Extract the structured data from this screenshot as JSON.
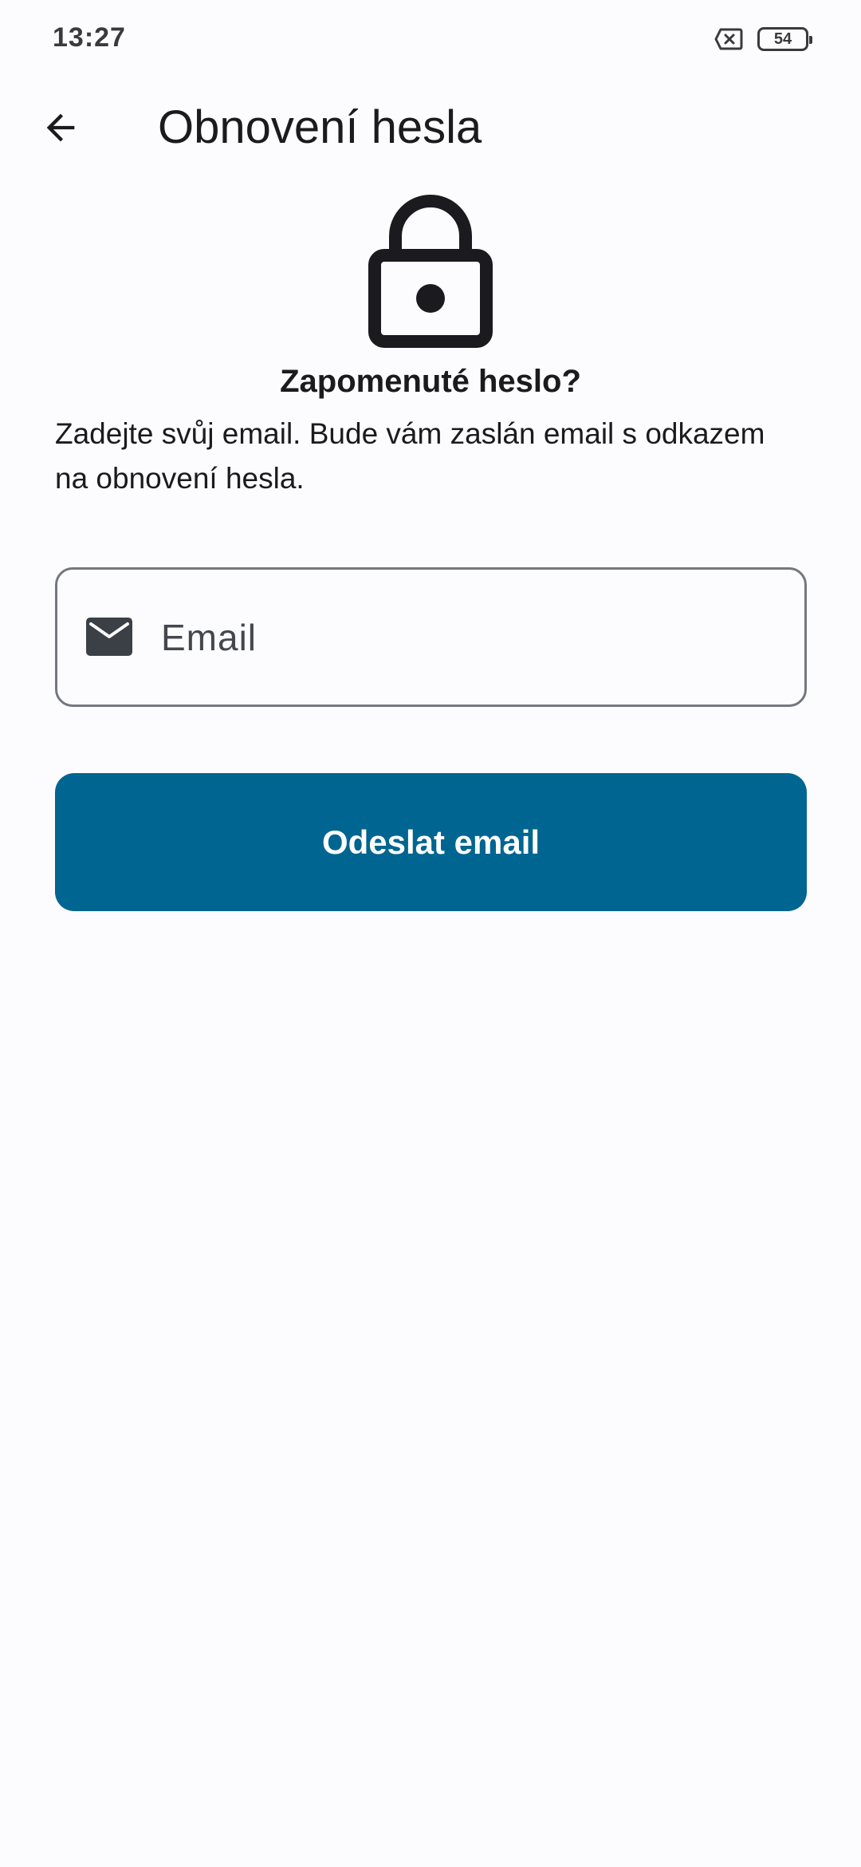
{
  "status_bar": {
    "time": "13:27",
    "battery": "54"
  },
  "top_bar": {
    "title": "Obnovení hesla"
  },
  "content": {
    "heading": "Zapomenuté heslo?",
    "description": "Zadejte svůj email. Bude vám zaslán email s odkazem na obnovení hesla.",
    "email_placeholder": "Email",
    "email_value": "",
    "submit_label": "Odeslat email"
  },
  "icons": {
    "back": "arrow-back-icon",
    "lock": "lock-icon",
    "mail": "mail-icon",
    "sim": "no-sim-icon",
    "battery": "battery-icon"
  },
  "colors": {
    "primary": "#006590",
    "background": "#fcfcff",
    "on_surface": "#1b1b1f",
    "outline": "#74777f",
    "icon_dark": "#3a4046"
  }
}
